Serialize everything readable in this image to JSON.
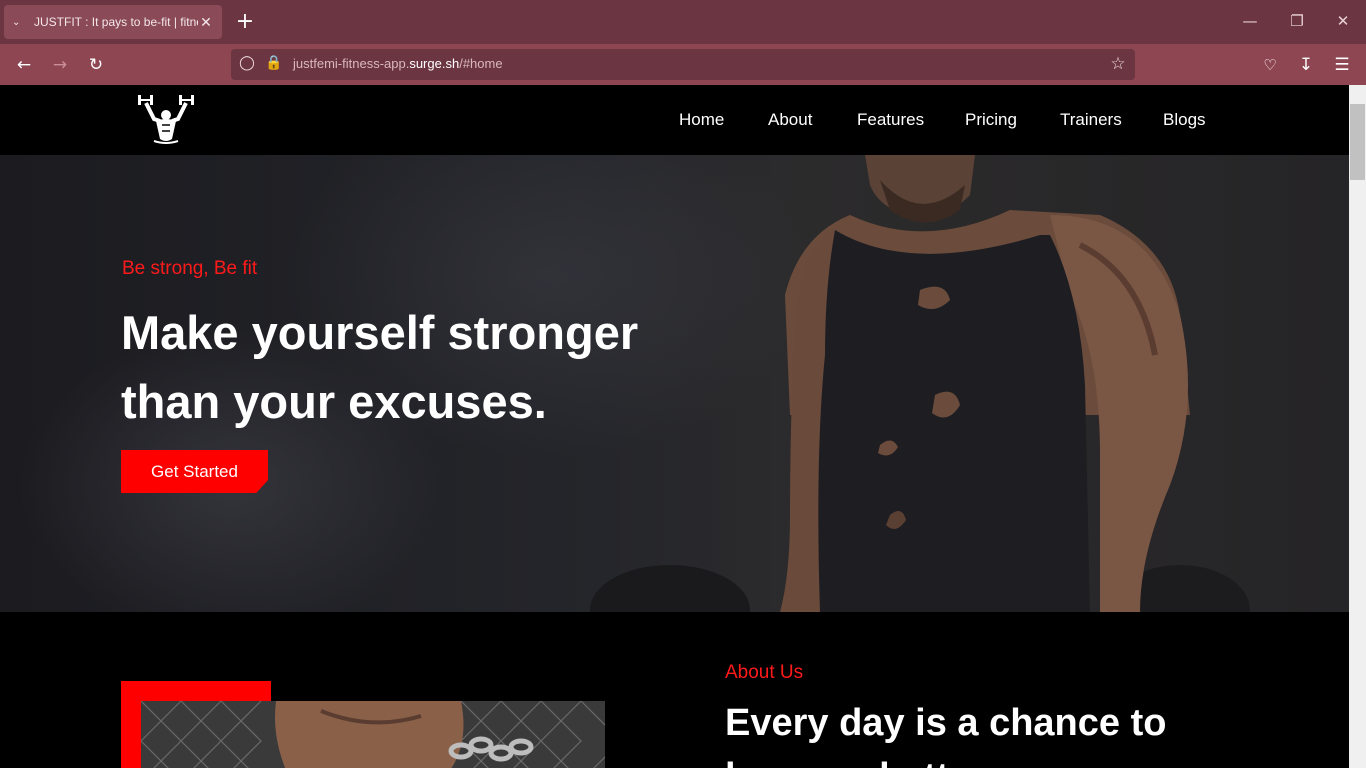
{
  "browser": {
    "tab_title": "JUSTFIT : It pays to be-fit | fitness",
    "url_prefix": "justfemi-fitness-app.",
    "url_domain": "surge.sh",
    "url_path": "/#home",
    "theme_color": "#8e4652"
  },
  "nav": {
    "items": [
      {
        "label": "Home"
      },
      {
        "label": "About"
      },
      {
        "label": "Features"
      },
      {
        "label": "Pricing"
      },
      {
        "label": "Trainers"
      },
      {
        "label": "Blogs"
      }
    ]
  },
  "hero": {
    "eyebrow": "Be strong, Be fit",
    "title": "Make yourself stronger than your excuses.",
    "cta_label": "Get Started",
    "accent_color": "#ff0000"
  },
  "about": {
    "eyebrow": "About Us",
    "title": "Every day is a chance to become better."
  }
}
